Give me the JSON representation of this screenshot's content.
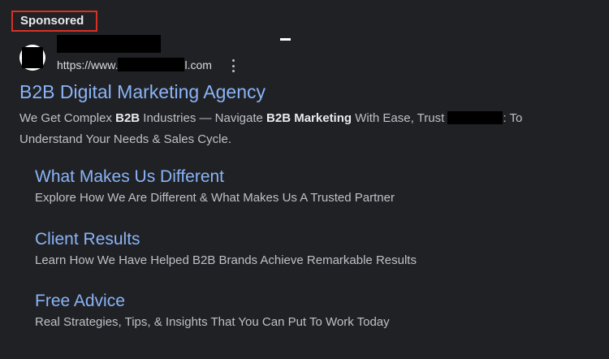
{
  "ad": {
    "sponsored_label": "Sponsored",
    "display_url_prefix": "https://www.",
    "display_url_suffix": "l.com",
    "headline": "B2B Digital Marketing Agency",
    "description": {
      "part1": "We Get Complex ",
      "bold1": "B2B",
      "part2": " Industries — Navigate ",
      "bold2": "B2B Marketing",
      "part3": " With Ease, Trust ",
      "part4": ": To Understand Your Needs & Sales Cycle."
    }
  },
  "sitelinks": [
    {
      "title": "What Makes Us Different",
      "description": "Explore How We Are Different & What Makes Us A Trusted Partner"
    },
    {
      "title": "Client Results",
      "description": "Learn How We Have Helped B2B Brands Achieve Remarkable Results"
    },
    {
      "title": "Free Advice",
      "description": "Real Strategies, Tips, & Insights That You Can Put To Work Today"
    }
  ],
  "colors": {
    "background": "#202124",
    "link": "#8ab4f8",
    "text": "#bdc1c6",
    "highlight_border": "#d93025"
  },
  "icons": {
    "favicon": "site-favicon-icon",
    "menu": "more-vertical-icon"
  }
}
